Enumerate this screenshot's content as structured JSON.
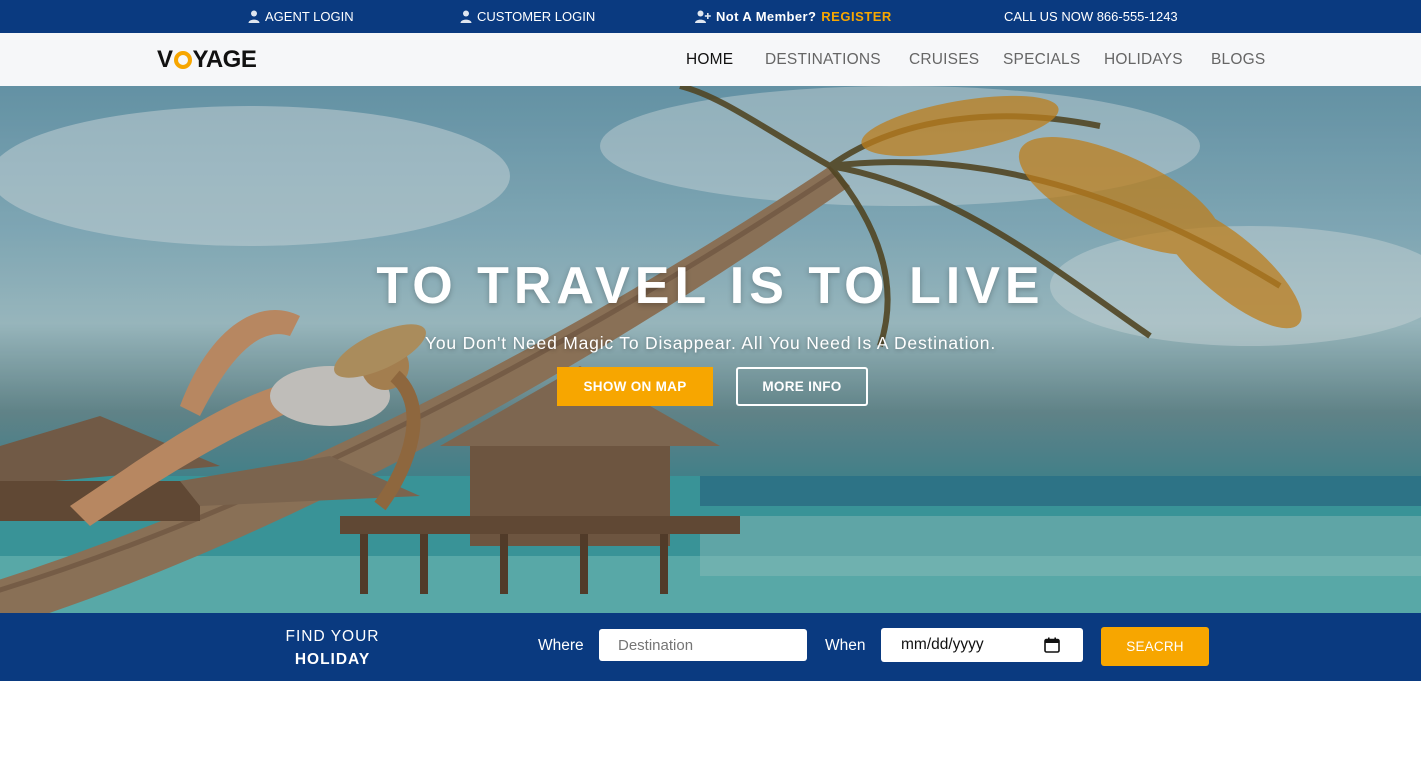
{
  "topbar": {
    "agent_login": "AGENT LOGIN",
    "customer_login": "CUSTOMER LOGIN",
    "not_member": "Not A Member?",
    "register": "REGISTER",
    "call": "CALL US NOW 866-555-1243",
    "icons": {
      "login": "user-icon",
      "register": "user-plus-icon"
    }
  },
  "brand": {
    "logo_v": "V",
    "logo_rest": "YAGE"
  },
  "nav": {
    "items": [
      {
        "label": "HOME",
        "active": true
      },
      {
        "label": "DESTINATIONS"
      },
      {
        "label": "CRUISES"
      },
      {
        "label": "SPECIALS"
      },
      {
        "label": "HOLIDAYS"
      },
      {
        "label": "BLOGS"
      }
    ]
  },
  "hero": {
    "title": "TO TRAVEL IS TO LIVE",
    "subtitle": "You Don't Need Magic To Disappear. All You Need Is A Destination.",
    "btn_map": "SHOW ON MAP",
    "btn_info": "MORE INFO"
  },
  "search": {
    "find_line1": "FIND YOUR",
    "find_line2": "HOLIDAY",
    "where_label": "Where",
    "destination_placeholder": "Destination",
    "when_label": "When",
    "date_placeholder": "mm/dd/yyyy",
    "button": "SEACRH",
    "icons": {
      "date": "calendar-icon"
    }
  },
  "colors": {
    "primary_blue": "#0a3a80",
    "accent_orange": "#f7a600"
  }
}
